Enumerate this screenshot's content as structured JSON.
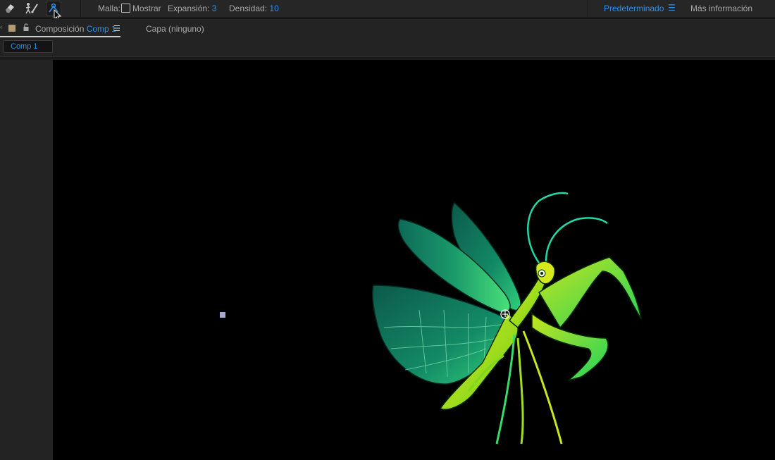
{
  "toolbar": {
    "tools": [
      {
        "icon": "eraser-icon",
        "active": false
      },
      {
        "icon": "puppet-brush-icon",
        "active": false
      },
      {
        "icon": "puppet-pin-icon",
        "active": true
      }
    ],
    "mesh_label": "Malla:",
    "show_label": "Mostrar",
    "expansion_label": "Expansión:",
    "expansion_value": "3",
    "density_label": "Densidad:",
    "density_value": "10",
    "workspace": "Predeterminado",
    "more_info": "Más información"
  },
  "tabs": {
    "composition_prefix": "Composición",
    "composition_name": "Comp 1",
    "layer": "Capa (ninguno)"
  },
  "flowchart": {
    "chip": "Comp 1"
  },
  "colors": {
    "accent": "#2f8fe6",
    "canvas": "#000000",
    "panel": "#232323"
  }
}
